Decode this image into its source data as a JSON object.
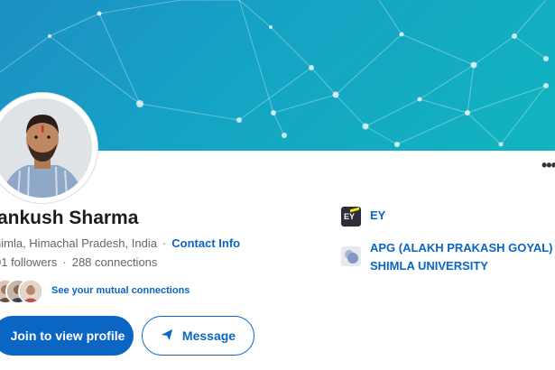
{
  "profile": {
    "name": "ankush Sharma",
    "location": "himla, Himachal Pradesh, India",
    "contact_label": "Contact Info",
    "followers": "01 followers",
    "connections": "288 connections",
    "mutual_label": "See your mutual connections"
  },
  "actions": {
    "join_label": "Join to view profile",
    "message_label": "Message"
  },
  "experience": [
    {
      "logo": "EY",
      "name": "EY"
    },
    {
      "logo": "university-logo",
      "name_line1": "APG (ALAKH PRAKASH GOYAL)",
      "name_line2": "SHIMLA UNIVERSITY"
    }
  ],
  "colors": {
    "accent": "#0a66c2",
    "cover_start": "#1d8fc4",
    "cover_end": "#12b4bf"
  },
  "icons": {
    "more": "more-horizontal-icon",
    "message": "send-icon"
  }
}
